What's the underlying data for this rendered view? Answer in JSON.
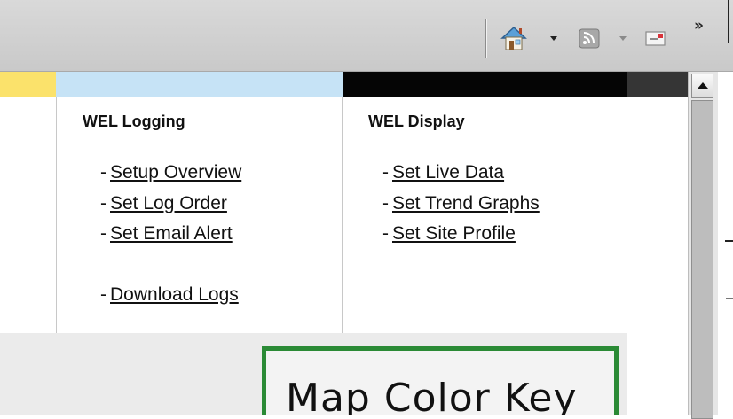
{
  "toolbar": {
    "icons": {
      "home": "home-icon",
      "feeds": "feed-icon",
      "mail": "mail-icon",
      "more": "chevron-double-right-icon"
    },
    "chevron_label": "»"
  },
  "colors": {
    "strip_yellow": "#fbe26b",
    "strip_blue": "#c6e3f6",
    "strip_black": "#050505",
    "map_key_border": "#2a8a35"
  },
  "menu": {
    "logging": {
      "heading": "WEL Logging",
      "links": [
        {
          "dash": "-",
          "label": "Setup Overview"
        },
        {
          "dash": "-",
          "label": "Set Log Order"
        },
        {
          "dash": "-",
          "label": "Set Email Alert"
        },
        {
          "dash": "-",
          "label": "Download Logs"
        }
      ]
    },
    "display": {
      "heading": "WEL Display",
      "links": [
        {
          "dash": "-",
          "label": "Set Live Data"
        },
        {
          "dash": "-",
          "label": "Set Trend Graphs"
        },
        {
          "dash": "-",
          "label": "Set Site Profile"
        }
      ]
    }
  },
  "map_key": {
    "title": "Map Color Key"
  }
}
